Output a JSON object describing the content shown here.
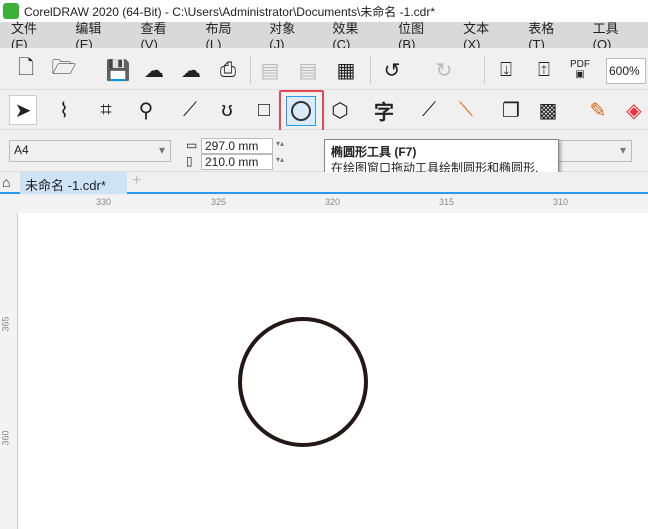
{
  "title": "CorelDRAW 2020 (64-Bit) - C:\\Users\\Administrator\\Documents\\未命名 -1.cdr*",
  "menu": [
    "文件(F)",
    "编辑(E)",
    "查看(V)",
    "布局(L)",
    "对象(J)",
    "效果(C)",
    "位图(B)",
    "文本(X)",
    "表格(T)",
    "工具(O)"
  ],
  "toolbar": {
    "zoom": "600%",
    "pdf": "PDF"
  },
  "toolbox": {
    "text_tool": "字",
    "active": "ellipse-tool"
  },
  "property": {
    "page_size": "A4",
    "width": "297.0 mm",
    "height": "210.0 mm"
  },
  "tooltip": {
    "title": "椭圆形工具 (F7)",
    "body": "在绘图窗口拖动工具绘制圆形和椭圆形."
  },
  "tabs": {
    "doc": "未命名 -1.cdr*",
    "add": "+"
  },
  "ruler": {
    "h": [
      "330",
      "325",
      "320",
      "315",
      "310"
    ],
    "v": [
      "365",
      "360"
    ]
  },
  "colors": {
    "accent": "#2b9af3",
    "highlight": "#e8475a",
    "circle": "#231815"
  }
}
